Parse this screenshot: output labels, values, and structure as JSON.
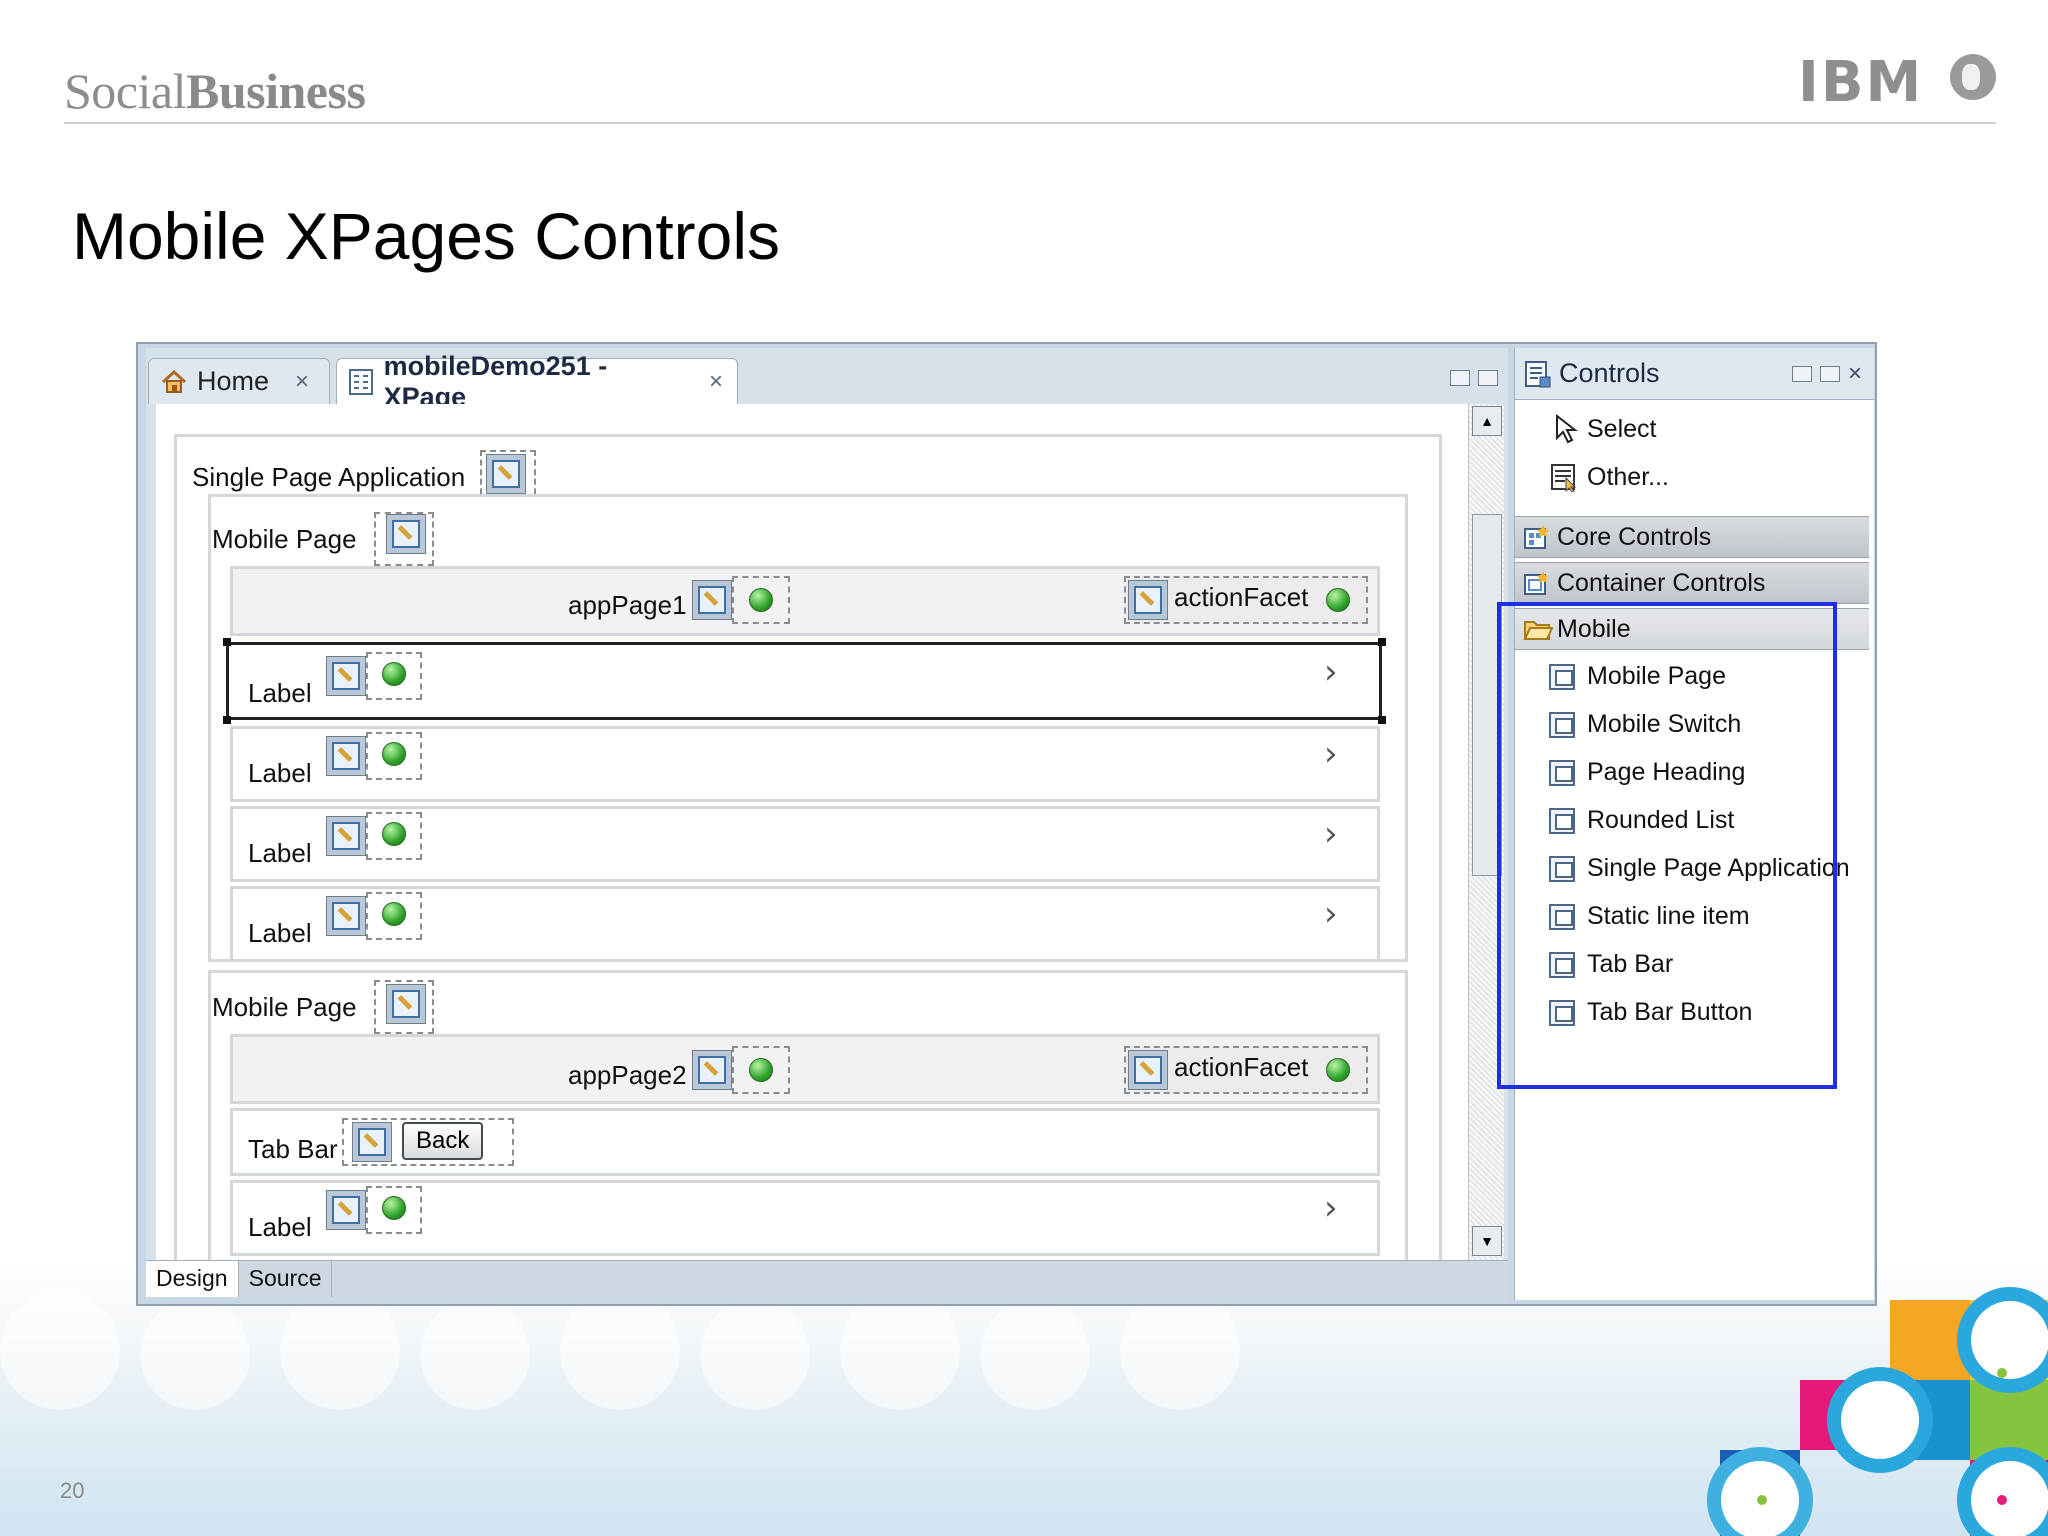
{
  "slide": {
    "brand_light": "Social",
    "brand_bold": "Business",
    "title": "Mobile XPages Controls",
    "page_number": "20",
    "logo_text": "IBM"
  },
  "editor": {
    "tabs": [
      {
        "label": "Home",
        "close": "×",
        "icon": "home-icon"
      },
      {
        "label": "mobileDemo251 - XPage",
        "close": "×",
        "icon": "xpage-icon"
      }
    ],
    "bottom_tabs": [
      "Design",
      "Source"
    ],
    "design": {
      "spa_label": "Single Page Application",
      "page1": {
        "label": "Mobile Page",
        "heading": "appPage1",
        "facet": "actionFacet",
        "rows": [
          "Label",
          "Label",
          "Label",
          "Label"
        ]
      },
      "page2": {
        "label": "Mobile Page",
        "heading": "appPage2",
        "facet": "actionFacet",
        "tabbar_label": "Tab Bar",
        "back_button": "Back",
        "rows": [
          "Label"
        ]
      }
    }
  },
  "palette": {
    "title": "Controls",
    "close": "×",
    "tools": [
      {
        "label": "Select",
        "icon": "cursor-icon"
      },
      {
        "label": "Other...",
        "icon": "other-icon"
      }
    ],
    "drawers": [
      {
        "label": "Core Controls",
        "icon": "core-controls-icon"
      },
      {
        "label": "Container Controls",
        "icon": "container-controls-icon"
      },
      {
        "label": "Mobile",
        "icon": "folder-open-icon"
      }
    ],
    "mobile_items": [
      "Mobile Page",
      "Mobile Switch",
      "Page Heading",
      "Rounded List",
      "Single Page Application",
      "Static line item",
      "Tab Bar",
      "Tab Bar Button"
    ],
    "highlight_color": "#1d2fe0"
  }
}
